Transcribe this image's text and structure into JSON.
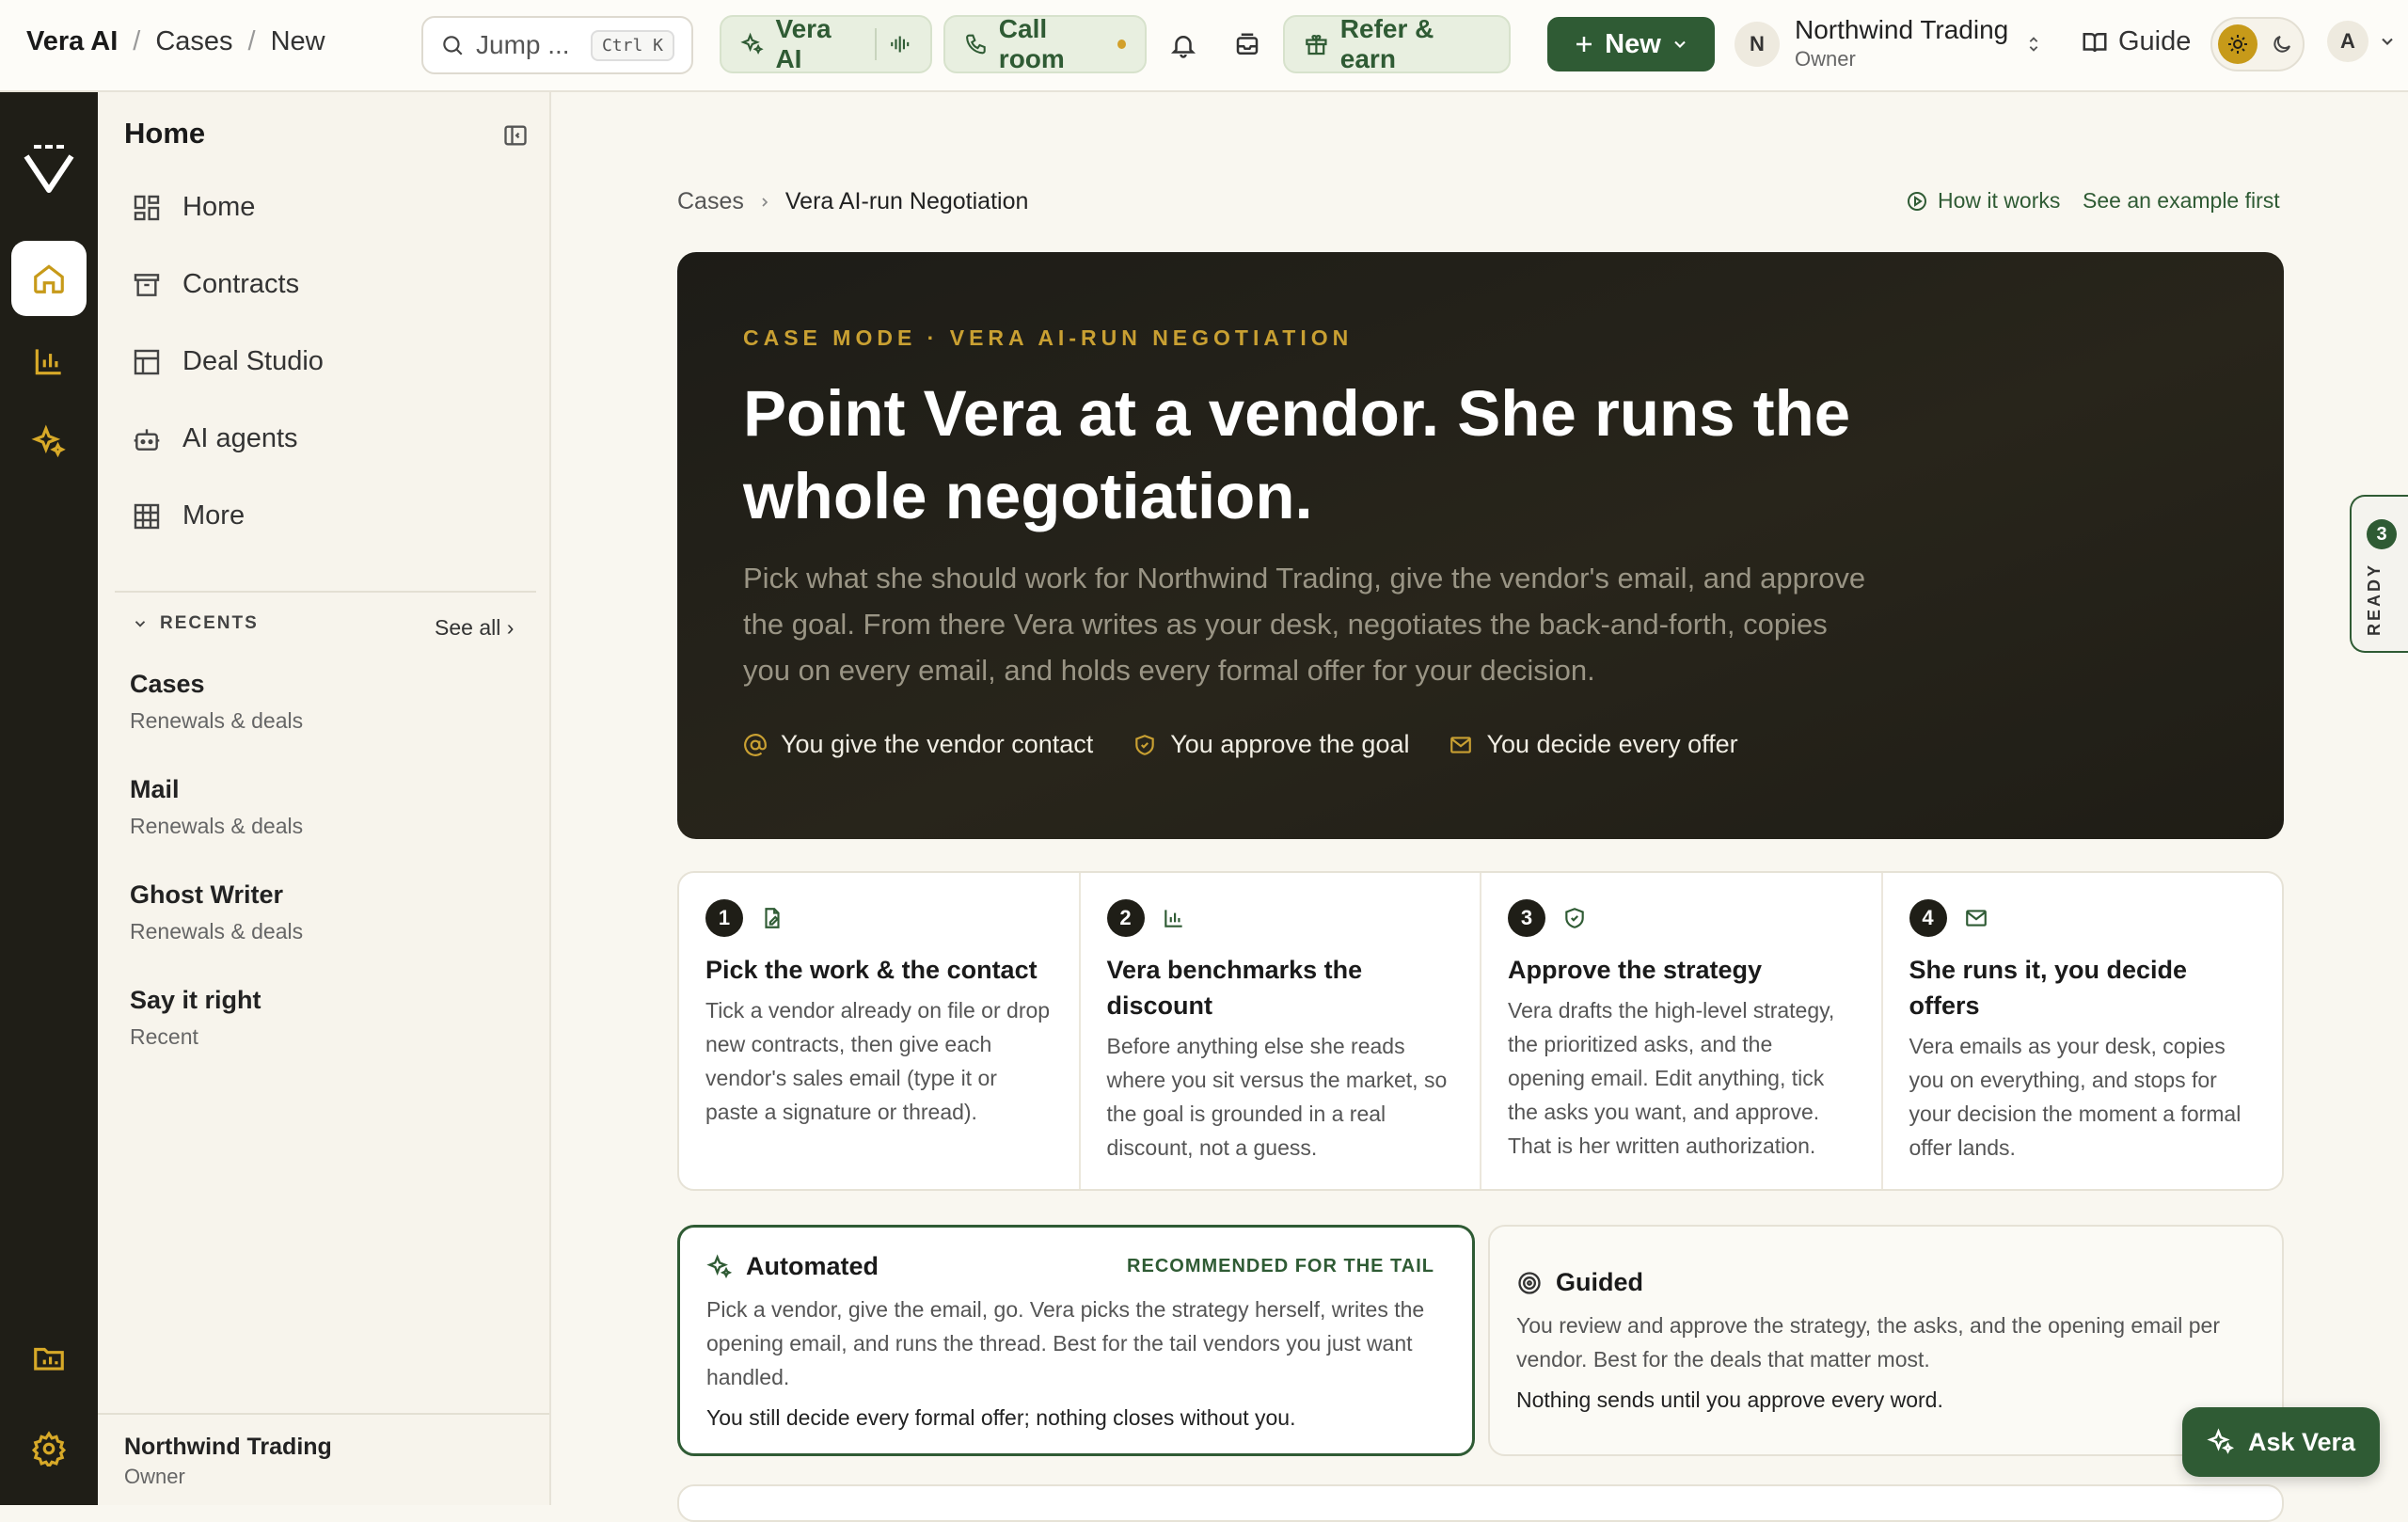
{
  "topbar": {
    "brand": "Vera AI",
    "crumbs": [
      "Cases",
      "New"
    ],
    "search_placeholder": "Jump ...",
    "search_shortcut": "Ctrl K",
    "vera_ai_label": "Vera AI",
    "call_room_label": "Call room",
    "refer_label": "Refer & earn",
    "new_label": "New",
    "org_initial": "N",
    "org_name": "Northwind Trading",
    "org_role": "Owner",
    "guide_label": "Guide",
    "account_initial": "A"
  },
  "sidebar": {
    "title": "Home",
    "nav": [
      "Home",
      "Contracts",
      "Deal Studio",
      "AI agents",
      "More"
    ],
    "recents_title": "RECENTS",
    "see_all": "See all ›",
    "recents": [
      {
        "title": "Cases",
        "sub": "Renewals & deals"
      },
      {
        "title": "Mail",
        "sub": "Renewals & deals"
      },
      {
        "title": "Ghost Writer",
        "sub": "Renewals & deals"
      },
      {
        "title": "Say it right",
        "sub": "Recent"
      }
    ],
    "footer_name": "Northwind Trading",
    "footer_role": "Owner"
  },
  "main": {
    "breadcrumb": [
      "Cases",
      "Vera AI-run Negotiation"
    ],
    "how_it_works": "How it works",
    "see_example": "See an example first",
    "hero": {
      "eyebrow": "CASE MODE · VERA AI-RUN NEGOTIATION",
      "title": "Point Vera at a vendor. She runs the whole negotiation.",
      "desc": "Pick what she should work for Northwind Trading, give the vendor's email, and approve the goal. From there Vera writes as your desk, negotiates the back-and-forth, copies you on every email, and holds every formal offer for your decision.",
      "chips": [
        "You give the vendor contact",
        "You approve the goal",
        "You decide every offer"
      ]
    },
    "steps": [
      {
        "num": "1",
        "title": "Pick the work & the contact",
        "desc": "Tick a vendor already on file or drop new contracts, then give each vendor's sales email (type it or paste a signature or thread)."
      },
      {
        "num": "2",
        "title": "Vera benchmarks the discount",
        "desc": "Before anything else she reads where you sit versus the market, so the goal is grounded in a real discount, not a guess."
      },
      {
        "num": "3",
        "title": "Approve the strategy",
        "desc": "Vera drafts the high-level strategy, the prioritized asks, and the opening email. Edit anything, tick the asks you want, and approve. That is her written authorization."
      },
      {
        "num": "4",
        "title": "She runs it, you decide offers",
        "desc": "Vera emails as your desk, copies you on everything, and stops for your decision the moment a formal offer lands."
      }
    ],
    "modes": {
      "auto": {
        "title": "Automated",
        "badge": "RECOMMENDED FOR THE TAIL",
        "desc": "Pick a vendor, give the email, go. Vera picks the strategy herself, writes the opening email, and runs the thread. Best for the tail vendors you just want handled.",
        "note": "You still decide every formal offer; nothing closes without you."
      },
      "guided": {
        "title": "Guided",
        "desc": "You review and approve the strategy, the asks, and the opening email per vendor. Best for the deals that matter most.",
        "note": "Nothing sends until you approve every word."
      }
    }
  },
  "ready_tab": {
    "count": "3",
    "label": "READY"
  },
  "ask_vera": "Ask Vera",
  "colors": {
    "accent": "#2f5b34",
    "gold": "#c9a032",
    "rail": "#1f1e17"
  }
}
